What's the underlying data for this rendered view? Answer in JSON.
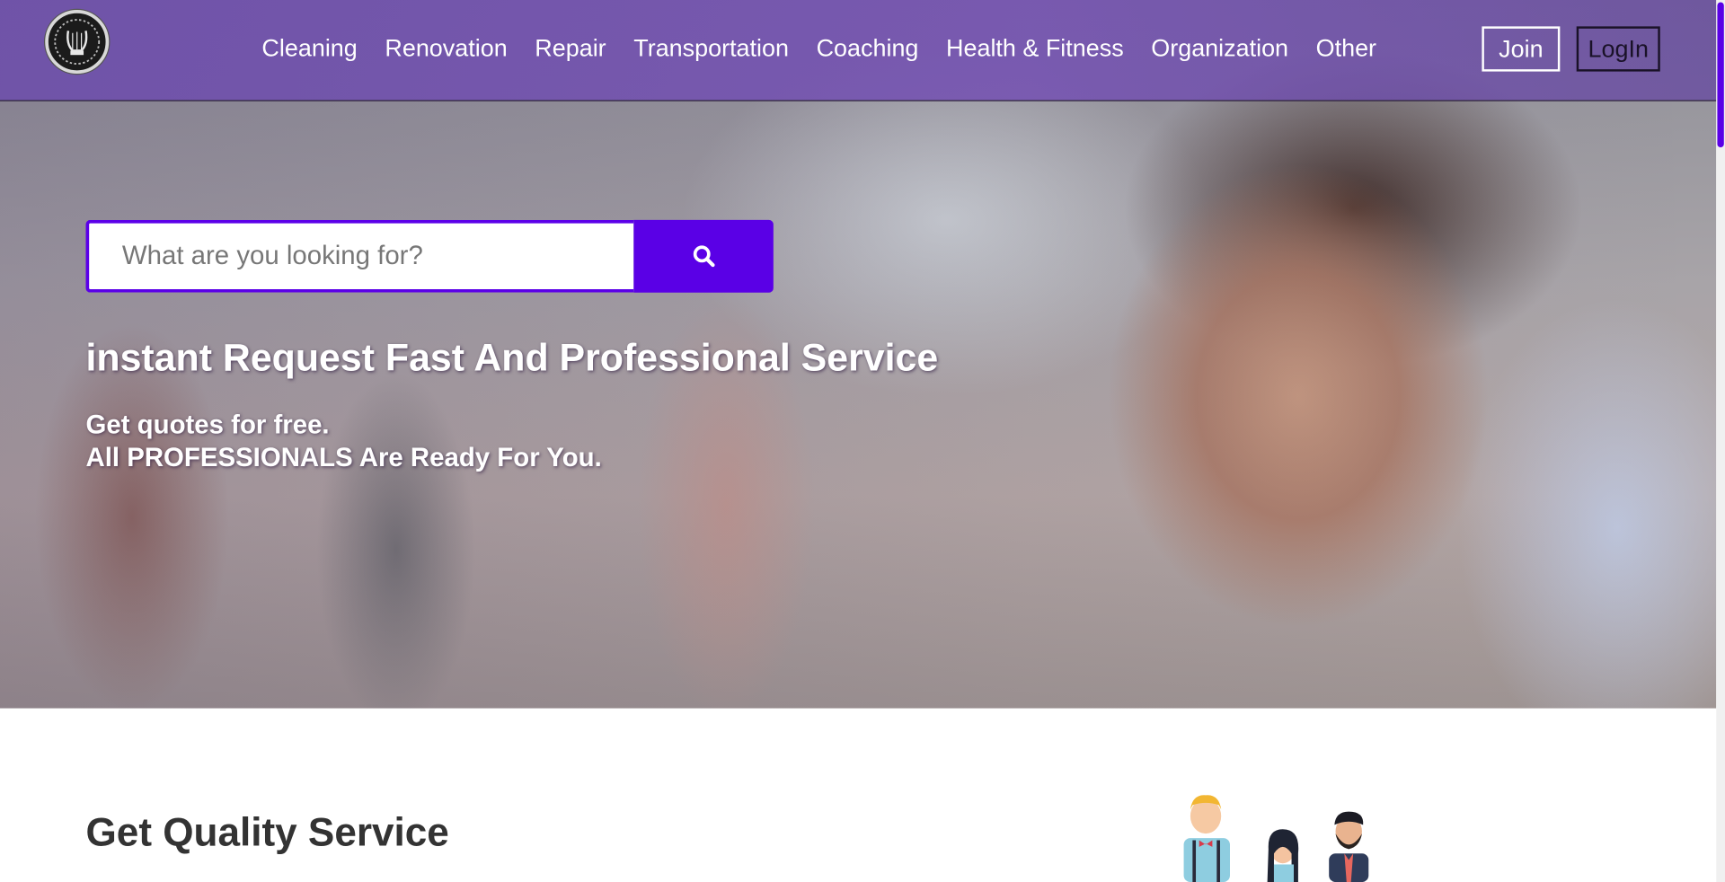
{
  "header": {
    "logo_icon": "lyre-emblem-icon",
    "nav_items": [
      "Cleaning",
      "Renovation",
      "Repair",
      "Transportation",
      "Coaching",
      "Health & Fitness",
      "Organization",
      "Other"
    ],
    "join_label": "Join",
    "login_label": "LogIn"
  },
  "search": {
    "placeholder": "What are you looking for?",
    "button_icon": "search-icon"
  },
  "hero": {
    "title": "instant Request Fast And Professional Service",
    "subtitle_line1": "Get quotes for free.",
    "subtitle_line2": "All PROFESSIONALS Are Ready For You."
  },
  "section": {
    "title": "Get Quality Service"
  },
  "colors": {
    "accent": "#5a00e6",
    "header": "#7654b2",
    "text_dark": "#333333"
  }
}
